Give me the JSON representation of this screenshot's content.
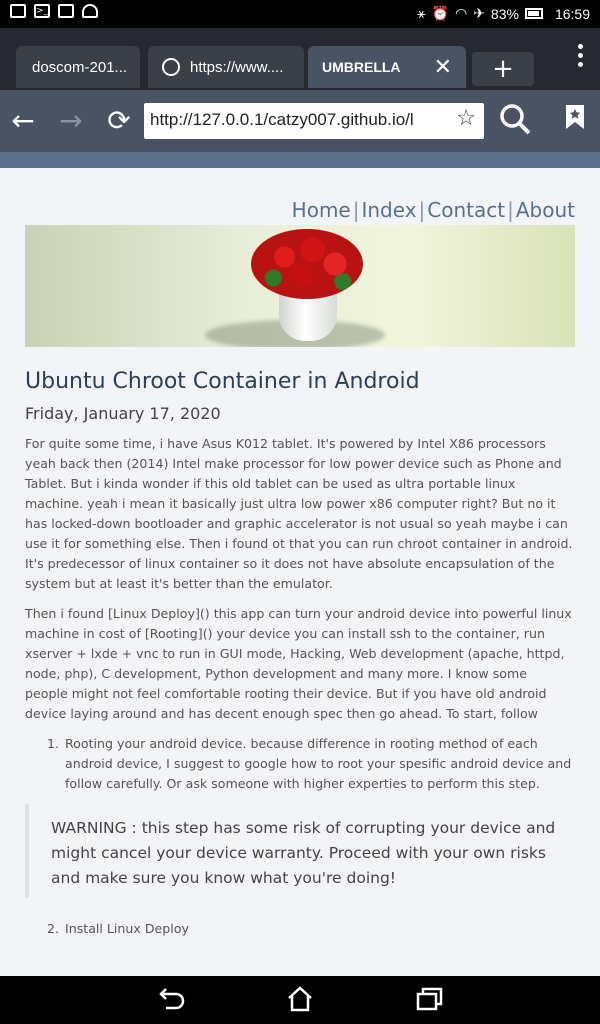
{
  "status_bar": {
    "battery": "83%",
    "time": "16:59"
  },
  "tabs": [
    {
      "label": "doscom-201..."
    },
    {
      "label": "https://www...."
    },
    {
      "label": "UMBRELLA"
    }
  ],
  "new_tab_label": "+",
  "address_bar": {
    "url": "http://127.0.0.1/catzy007.github.io/l"
  },
  "site_nav": {
    "home": "Home",
    "index": "Index",
    "contact": "Contact",
    "about": "About",
    "separator": "|"
  },
  "post": {
    "title": "Ubuntu Chroot Container in Android",
    "date": "Friday, January 17, 2020",
    "paragraph_1": "For quite some time, i have Asus K012 tablet. It's powered by Intel X86 processors yeah back then (2014) Intel make processor for low power device such as Phone and Tablet. But i kinda wonder if this old tablet can be used as ultra portable linux machine. yeah i mean it basically just ultra low power x86 computer right? But no it has locked-down bootloader and graphic accelerator is not usual so yeah maybe i can use it for something else. Then i found ot that you can run chroot container in android. It's predecessor of linux container so it does not have absolute encapsulation of the system but at least it's better than the emulator.",
    "paragraph_2": "Then i found [Linux Deploy]() this app can turn your android device into powerful linux machine in cost of [Rooting]() your device you can install ssh to the container, run xserver + lxde + vnc to run in GUI mode, Hacking, Web development (apache, httpd, node, php), C development, Python development and many more. I know some people might not feel comfortable rooting their device. But if you have old android device laying around and has decent enough spec then go ahead. To start, follow",
    "steps": [
      {
        "number": "1.",
        "text": "Rooting your android device. because difference in rooting method of each android device, I suggest to google how to root your spesific android device and follow carefully. Or ask someone with higher experties to perform this step."
      },
      {
        "number": "2.",
        "text": "Install Linux Deploy"
      }
    ],
    "warning": "WARNING : this step has some risk of corrupting your device and might cancel your device warranty. Proceed with your own risks and make sure you know what you're doing!"
  },
  "colors": {
    "toolbar": "#4a5363",
    "tabstrip": "#262a30",
    "page_bg": "#f2f4f7",
    "link": "#5a6f94",
    "title": "#2e3e55"
  }
}
